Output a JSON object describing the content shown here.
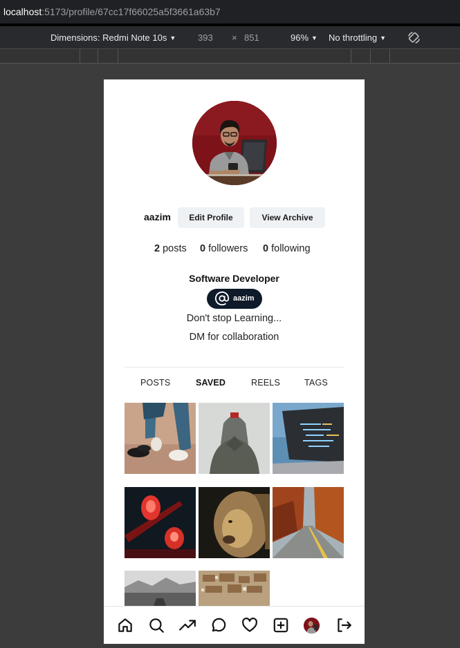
{
  "browser": {
    "url_host": "localhost",
    "url_path": ":5173/profile/67cc17f66025a5f3661a63b7"
  },
  "devtools": {
    "dimensions_label": "Dimensions: Redmi Note 10s",
    "width": "393",
    "times": "×",
    "height": "851",
    "zoom": "96%",
    "throttling": "No throttling",
    "rotate_icon": "rotate-icon"
  },
  "profile": {
    "username": "aazim",
    "edit_label": "Edit Profile",
    "archive_label": "View Archive",
    "posts_count": "2",
    "posts_label": "posts",
    "followers_count": "0",
    "followers_label": "followers",
    "following_count": "0",
    "following_label": "following",
    "bio_title": "Software Developer",
    "threads_handle": "aazim",
    "bio_line1": "Don't stop Learning...",
    "bio_line2": "DM for collaboration"
  },
  "tabs": [
    {
      "label": "POSTS",
      "active": false
    },
    {
      "label": "SAVED",
      "active": true
    },
    {
      "label": "REELS",
      "active": false
    },
    {
      "label": "TAGS",
      "active": false
    }
  ],
  "grid": [
    {
      "subject": "sneakers-photo"
    },
    {
      "subject": "hooded-figure-photo"
    },
    {
      "subject": "laptop-code-photo"
    },
    {
      "subject": "red-lamp-photo"
    },
    {
      "subject": "lion-photo"
    },
    {
      "subject": "autumn-road-photo"
    },
    {
      "subject": "mountain-road-photo"
    },
    {
      "subject": "city-aerial-photo"
    }
  ],
  "nav": [
    "home-icon",
    "search-icon",
    "trending-icon",
    "chat-icon",
    "heart-icon",
    "add-post-icon",
    "profile-avatar",
    "logout-icon"
  ]
}
